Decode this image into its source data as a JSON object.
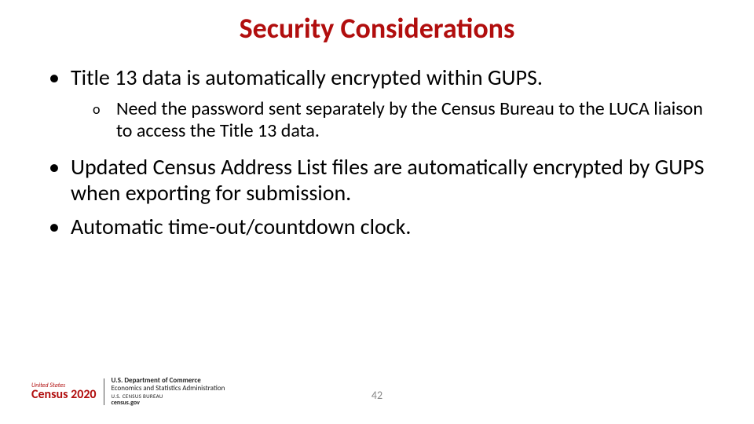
{
  "title": "Security Considerations",
  "bullets": {
    "b1": "Title 13 data is automatically encrypted within GUPS.",
    "b1_sub": "Need the password sent separately by the Census Bureau to the LUCA liaison to access the Title 13 data.",
    "b2": "Updated Census Address List files are automatically encrypted by GUPS when exporting for submission.",
    "b3": "Automatic time-out/countdown clock."
  },
  "footer": {
    "logo_line1": "United States",
    "logo_line2": "Census",
    "logo_year": "2020",
    "dept_line1": "U.S. Department of Commerce",
    "dept_line2": "Economics and Statistics Administration",
    "dept_line3": "U.S. CENSUS BUREAU",
    "dept_line4": "census.gov"
  },
  "page_number": "42",
  "markers": {
    "disc": "•",
    "circle": "o"
  }
}
